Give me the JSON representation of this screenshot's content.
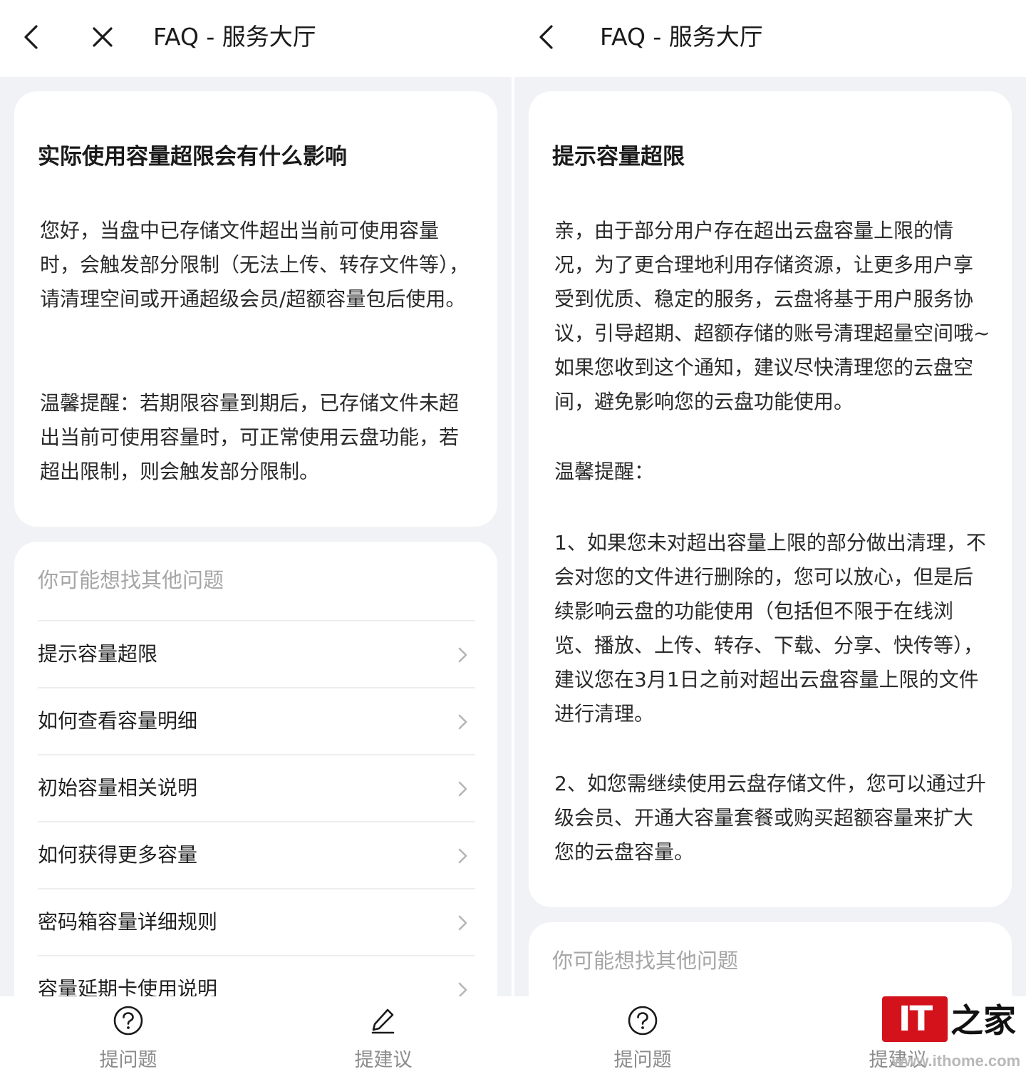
{
  "left": {
    "header": {
      "title": "FAQ - 服务大厅",
      "back_icon": "chevron-left-icon",
      "close_icon": "close-icon"
    },
    "article": {
      "title": "实际使用容量超限会有什么影响",
      "paragraphs": [
        "您好，当盘中已存储文件超出当前可使用容量时，会触发部分限制（无法上传、转存文件等），请清理空间或开通超级会员/超额容量包后使用。",
        "温馨提醒：若期限容量到期后，已存储文件未超出当前可使用容量时，可正常使用云盘功能，若超出限制，则会触发部分限制。"
      ]
    },
    "related": {
      "header": "你可能想找其他问题",
      "items": [
        {
          "label": "提示容量超限"
        },
        {
          "label": "如何查看容量明细"
        },
        {
          "label": "初始容量相关说明"
        },
        {
          "label": "如何获得更多容量"
        },
        {
          "label": "密码箱容量详细规则"
        },
        {
          "label": "容量延期卡使用说明"
        }
      ]
    },
    "bottombar": {
      "ask_label": "提问题",
      "suggest_label": "提建议"
    }
  },
  "right": {
    "header": {
      "title": "FAQ - 服务大厅",
      "back_icon": "chevron-left-icon"
    },
    "article": {
      "title": "提示容量超限",
      "paragraphs": [
        "亲，由于部分用户存在超出云盘容量上限的情况，为了更合理地利用存储资源，让更多用户享受到优质、稳定的服务，云盘将基于用户服务协议，引导超期、超额存储的账号清理超量空间哦~如果您收到这个通知，建议尽快清理您的云盘空间，避免影响您的云盘功能使用。",
        "温馨提醒：",
        "1、如果您未对超出容量上限的部分做出清理，不会对您的文件进行删除的，您可以放心，但是后续影响云盘的功能使用（包括但不限于在线浏览、播放、上传、转存、下载、分享、快传等），建议您在3月1日之前对超出云盘容量上限的文件进行清理。",
        "2、如您需继续使用云盘存储文件，您可以通过升级会员、开通大容量套餐或购买超额容量来扩大您的云盘容量。"
      ]
    },
    "related": {
      "header": "你可能想找其他问题"
    },
    "bottombar": {
      "ask_label": "提问题",
      "suggest_label": "提建议"
    }
  },
  "watermark": {
    "logo_text": "IT",
    "brush_text": "之家",
    "url": "www.ithome.com"
  },
  "colors": {
    "page_bg": "#f1f2f6",
    "card_bg": "#ffffff",
    "muted_text": "#a6a6a6",
    "watermark_red": "#d3121b"
  }
}
